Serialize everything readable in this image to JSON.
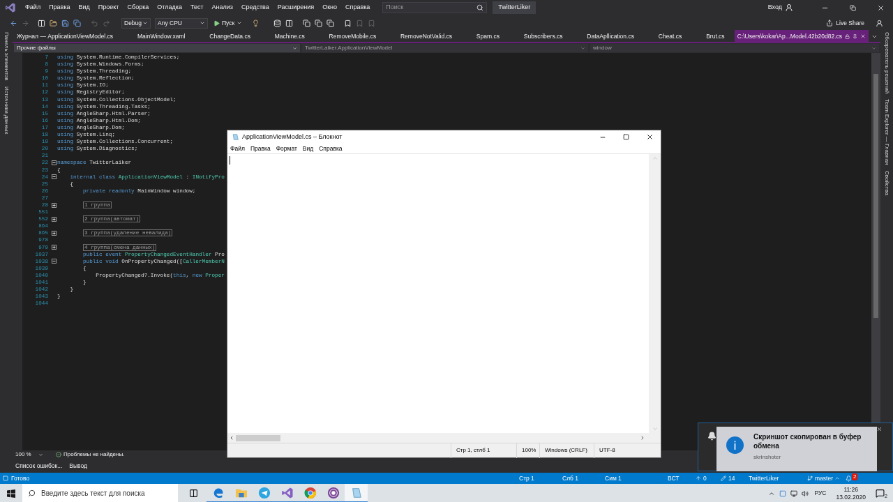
{
  "menu": [
    "Файл",
    "Правка",
    "Вид",
    "Проект",
    "Сборка",
    "Отладка",
    "Тест",
    "Анализ",
    "Средства",
    "Расширения",
    "Окно",
    "Справка"
  ],
  "search": {
    "placeholder": "Поиск"
  },
  "solution_badge": "TwitterLiker",
  "sign_in": "Вход",
  "toolbar": {
    "configuration": "Debug",
    "platform": "Any CPU",
    "start": "Пуск",
    "live_share": "Live Share"
  },
  "left_panels": [
    "Панель элементов",
    "Источники данных"
  ],
  "right_panels": [
    "Обозреватель решений",
    "Team Explorer — Главная",
    "Свойства"
  ],
  "tabs": [
    {
      "label": "Журнал — ApplicationViewModel.cs",
      "selected": false
    },
    {
      "label": "MainWindow.xaml",
      "selected": false
    },
    {
      "label": "ChangeData.cs",
      "selected": false
    },
    {
      "label": "Machine.cs",
      "selected": false
    },
    {
      "label": "RemoveMobile.cs",
      "selected": false
    },
    {
      "label": "RemoveNotValid.cs",
      "selected": false
    },
    {
      "label": "Spam.cs",
      "selected": false
    },
    {
      "label": "Subscribers.cs",
      "selected": false
    },
    {
      "label": "DataApllication.cs",
      "selected": false
    },
    {
      "label": "Cheat.cs",
      "selected": false
    },
    {
      "label": "Brut.cs",
      "selected": false
    },
    {
      "label": "C:\\Users\\kokar\\Ap...Model.42b20d82.cs",
      "selected": true
    }
  ],
  "navigation": {
    "project": "Прочие файлы",
    "type": "TwitterLaiker.ApplicationViewModel",
    "member": "window"
  },
  "code_lines": [
    {
      "number": "7",
      "segments": [
        {
          "text": "using ",
          "kind": "keyword"
        },
        {
          "text": "System.Runtime.CompilerServices;",
          "kind": "plain"
        }
      ]
    },
    {
      "number": "8",
      "segments": [
        {
          "text": "using ",
          "kind": "keyword"
        },
        {
          "text": "System.Windows.Forms;",
          "kind": "plain"
        }
      ]
    },
    {
      "number": "9",
      "segments": [
        {
          "text": "using ",
          "kind": "keyword"
        },
        {
          "text": "System.Threading;",
          "kind": "plain"
        }
      ]
    },
    {
      "number": "10",
      "segments": [
        {
          "text": "using ",
          "kind": "keyword"
        },
        {
          "text": "System.Reflection;",
          "kind": "plain"
        }
      ]
    },
    {
      "number": "11",
      "segments": [
        {
          "text": "using ",
          "kind": "keyword"
        },
        {
          "text": "System.IO;",
          "kind": "plain"
        }
      ]
    },
    {
      "number": "12",
      "segments": [
        {
          "text": "using ",
          "kind": "keyword"
        },
        {
          "text": "RegistryEditor;",
          "kind": "plain"
        }
      ]
    },
    {
      "number": "13",
      "segments": [
        {
          "text": "using ",
          "kind": "keyword"
        },
        {
          "text": "System.Collections.ObjectModel;",
          "kind": "plain"
        }
      ]
    },
    {
      "number": "14",
      "segments": [
        {
          "text": "using ",
          "kind": "keyword"
        },
        {
          "text": "System.Threading.Tasks;",
          "kind": "plain"
        }
      ]
    },
    {
      "number": "15",
      "segments": [
        {
          "text": "using ",
          "kind": "keyword"
        },
        {
          "text": "AngleSharp.Html.Parser;",
          "kind": "plain"
        }
      ]
    },
    {
      "number": "16",
      "segments": [
        {
          "text": "using ",
          "kind": "keyword"
        },
        {
          "text": "AngleSharp.Html.Dom;",
          "kind": "plain"
        }
      ]
    },
    {
      "number": "17",
      "segments": [
        {
          "text": "using ",
          "kind": "keyword"
        },
        {
          "text": "AngleSharp.Dom;",
          "kind": "plain"
        }
      ]
    },
    {
      "number": "18",
      "segments": [
        {
          "text": "using ",
          "kind": "keyword"
        },
        {
          "text": "System.Linq;",
          "kind": "plain"
        }
      ]
    },
    {
      "number": "19",
      "segments": [
        {
          "text": "using ",
          "kind": "keyword"
        },
        {
          "text": "System.Collections.Concurrent;",
          "kind": "plain"
        }
      ]
    },
    {
      "number": "20",
      "segments": [
        {
          "text": "using ",
          "kind": "keyword"
        },
        {
          "text": "System.Diagnostics;",
          "kind": "plain"
        }
      ]
    },
    {
      "number": "21"
    },
    {
      "number": "22",
      "folded": false,
      "segments": [
        {
          "text": "namespace ",
          "kind": "keyword"
        },
        {
          "text": "TwitterLaiker",
          "kind": "plain"
        }
      ]
    },
    {
      "number": "23",
      "segments": [
        {
          "text": "{",
          "kind": "plain"
        }
      ]
    },
    {
      "number": "24",
      "folded": false,
      "segments": [
        {
          "text": "    internal class ",
          "kind": "keyword"
        },
        {
          "text": "ApplicationViewModel",
          "kind": "type"
        },
        {
          "text": " : ",
          "kind": "plain"
        },
        {
          "text": "INotifyPro",
          "kind": "type"
        }
      ]
    },
    {
      "number": "25",
      "segments": [
        {
          "text": "    {",
          "kind": "plain"
        }
      ]
    },
    {
      "number": "26",
      "segments": [
        {
          "text": "        private readonly ",
          "kind": "keyword"
        },
        {
          "text": "MainWindow window;",
          "kind": "plain"
        }
      ]
    },
    {
      "number": "27"
    },
    {
      "number": "28",
      "folded": true,
      "segments": [
        {
          "text": "        1 группа",
          "kind": "region"
        }
      ]
    },
    {
      "number": "551"
    },
    {
      "number": "552",
      "folded": true,
      "segments": [
        {
          "text": "        2 группа(автомат)",
          "kind": "region"
        }
      ]
    },
    {
      "number": "864"
    },
    {
      "number": "865",
      "folded": true,
      "segments": [
        {
          "text": "        3 группа(удаление невалида)",
          "kind": "region"
        }
      ]
    },
    {
      "number": "978"
    },
    {
      "number": "979",
      "folded": true,
      "segments": [
        {
          "text": "        4 группа(смена данных)",
          "kind": "region"
        }
      ]
    },
    {
      "number": "1037",
      "segments": [
        {
          "text": "        public event ",
          "kind": "keyword"
        },
        {
          "text": "PropertyChangedEventHandler",
          "kind": "type"
        },
        {
          "text": " Pro",
          "kind": "plain"
        }
      ]
    },
    {
      "number": "1038",
      "folded": false,
      "segments": [
        {
          "text": "        public void ",
          "kind": "keyword"
        },
        {
          "text": "OnPropertyChanged([",
          "kind": "plain"
        },
        {
          "text": "CallerMemberN",
          "kind": "type"
        }
      ]
    },
    {
      "number": "1039",
      "segments": [
        {
          "text": "        {",
          "kind": "plain"
        }
      ]
    },
    {
      "number": "1040",
      "segments": [
        {
          "text": "            PropertyChanged?.Invoke(",
          "kind": "plain"
        },
        {
          "text": "this",
          "kind": "keyword"
        },
        {
          "text": ", ",
          "kind": "plain"
        },
        {
          "text": "new ",
          "kind": "keyword"
        },
        {
          "text": "Proper",
          "kind": "type"
        }
      ]
    },
    {
      "number": "1041",
      "segments": [
        {
          "text": "        }",
          "kind": "plain"
        }
      ]
    },
    {
      "number": "1042",
      "segments": [
        {
          "text": "    }",
          "kind": "plain"
        }
      ]
    },
    {
      "number": "1043",
      "segments": [
        {
          "text": "}",
          "kind": "plain"
        }
      ]
    },
    {
      "number": "1044"
    }
  ],
  "editor_status": {
    "zoom": "100 %",
    "issues": "Проблемы не найдены."
  },
  "bottom_tabs": [
    "Список ошибок...",
    "Вывод"
  ],
  "status_bar": {
    "state": "Готово",
    "line": "Стр 1",
    "column": "Слб 1",
    "char": "Сим 1",
    "mode": "ВСТ",
    "push": "0",
    "changes": "14",
    "repo": "TwitterLiker",
    "branch": "master",
    "notifications": "2"
  },
  "notepad": {
    "title": "ApplicationViewModel.cs – Блокнот",
    "menu": [
      "Файл",
      "Правка",
      "Формат",
      "Вид",
      "Справка"
    ],
    "status": [
      "Стр 1, стлб 1",
      "100%",
      "Windows (CRLF)",
      "UTF-8"
    ]
  },
  "toast": {
    "title": "Скриншот скопирован в буфер обмена",
    "source": "skrinshoter"
  },
  "taskbar": {
    "search_placeholder": "Введите здесь текст для поиска",
    "apps": [
      {
        "kind": "edge",
        "selected": false
      },
      {
        "kind": "explorer",
        "selected": false
      },
      {
        "kind": "telegram",
        "selected": false
      },
      {
        "kind": "visual-studio",
        "selected": false
      },
      {
        "kind": "chrome",
        "selected": false
      },
      {
        "kind": "tor",
        "selected": false
      },
      {
        "kind": "notepad",
        "selected": true
      }
    ],
    "language": "РУС",
    "time": "11:26",
    "date": "13.02.2020",
    "notification_count": "2"
  }
}
